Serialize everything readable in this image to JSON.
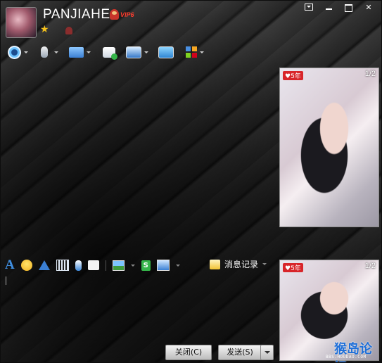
{
  "contact": {
    "nickname": "PANJIAHE",
    "vip_label": "VIP6"
  },
  "icons": {
    "star": "★",
    "send_file_glyph": "S"
  },
  "video_panels": [
    {
      "badge": "♥5年",
      "page": "1/2"
    },
    {
      "badge": "♥5年",
      "page": "1/2"
    }
  ],
  "input_toolbar": {
    "font_glyph": "A",
    "history_label": "消息记录"
  },
  "buttons": {
    "close_label": "关闭(C)",
    "send_label": "发送(S)"
  },
  "watermark": {
    "text": "猴岛论坛",
    "url": "BBS.HOUDAO.COM"
  },
  "colors": {
    "accent_blue": "#1f6fd8",
    "vip_red": "#ff3d2e"
  }
}
